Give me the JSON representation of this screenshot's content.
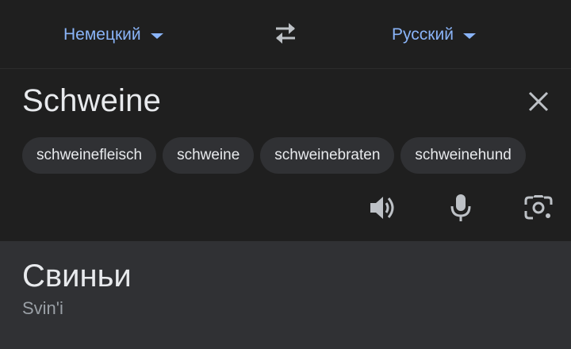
{
  "language_bar": {
    "source_language": "Немецкий",
    "target_language": "Русский",
    "caret_icon": "caret-down-icon",
    "swap_icon": "swap-arrows-icon"
  },
  "input": {
    "text": "Schweine",
    "clear_icon": "close-icon",
    "suggestions": [
      "schweinefleisch",
      "schweine",
      "schweinebraten",
      "schweinehund"
    ],
    "tools": {
      "speaker_icon": "speaker-icon",
      "mic_icon": "microphone-icon",
      "camera_icon": "camera-lens-icon"
    }
  },
  "output": {
    "translation": "Свиньи",
    "transliteration": "Svin'i"
  },
  "colors": {
    "accent": "#8ab4f8",
    "background": "#1f1f1f",
    "panel": "#303134",
    "text": "#e8eaed",
    "muted_text": "#9aa0a6",
    "icon": "#bdc1c6"
  }
}
